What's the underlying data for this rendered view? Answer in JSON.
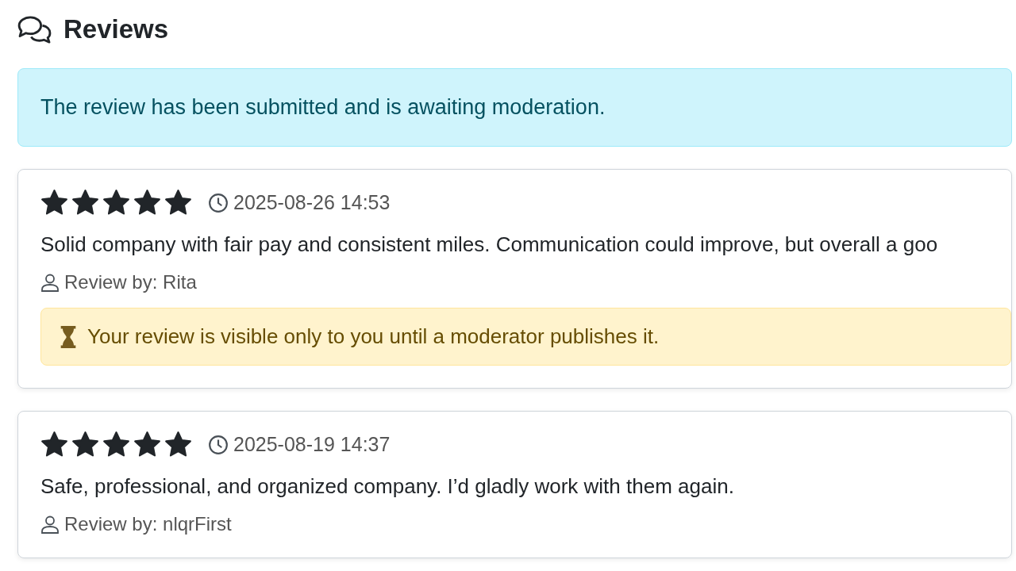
{
  "heading": "Reviews",
  "alert": "The review has been submitted and is awaiting moderation.",
  "reviews": [
    {
      "stars": 5,
      "date": "2025-08-26 14:53",
      "text": "Solid company with fair pay and consistent miles. Communication could improve, but overall a goo",
      "author": "Review by: Rita",
      "pending_note": "Your review is visible only to you until a moderator publishes it."
    },
    {
      "stars": 5,
      "date": "2025-08-19 14:37",
      "text": "Safe, professional, and organized company. I’d gladly work with them again.",
      "author": "Review by: nlqrFirst"
    }
  ]
}
